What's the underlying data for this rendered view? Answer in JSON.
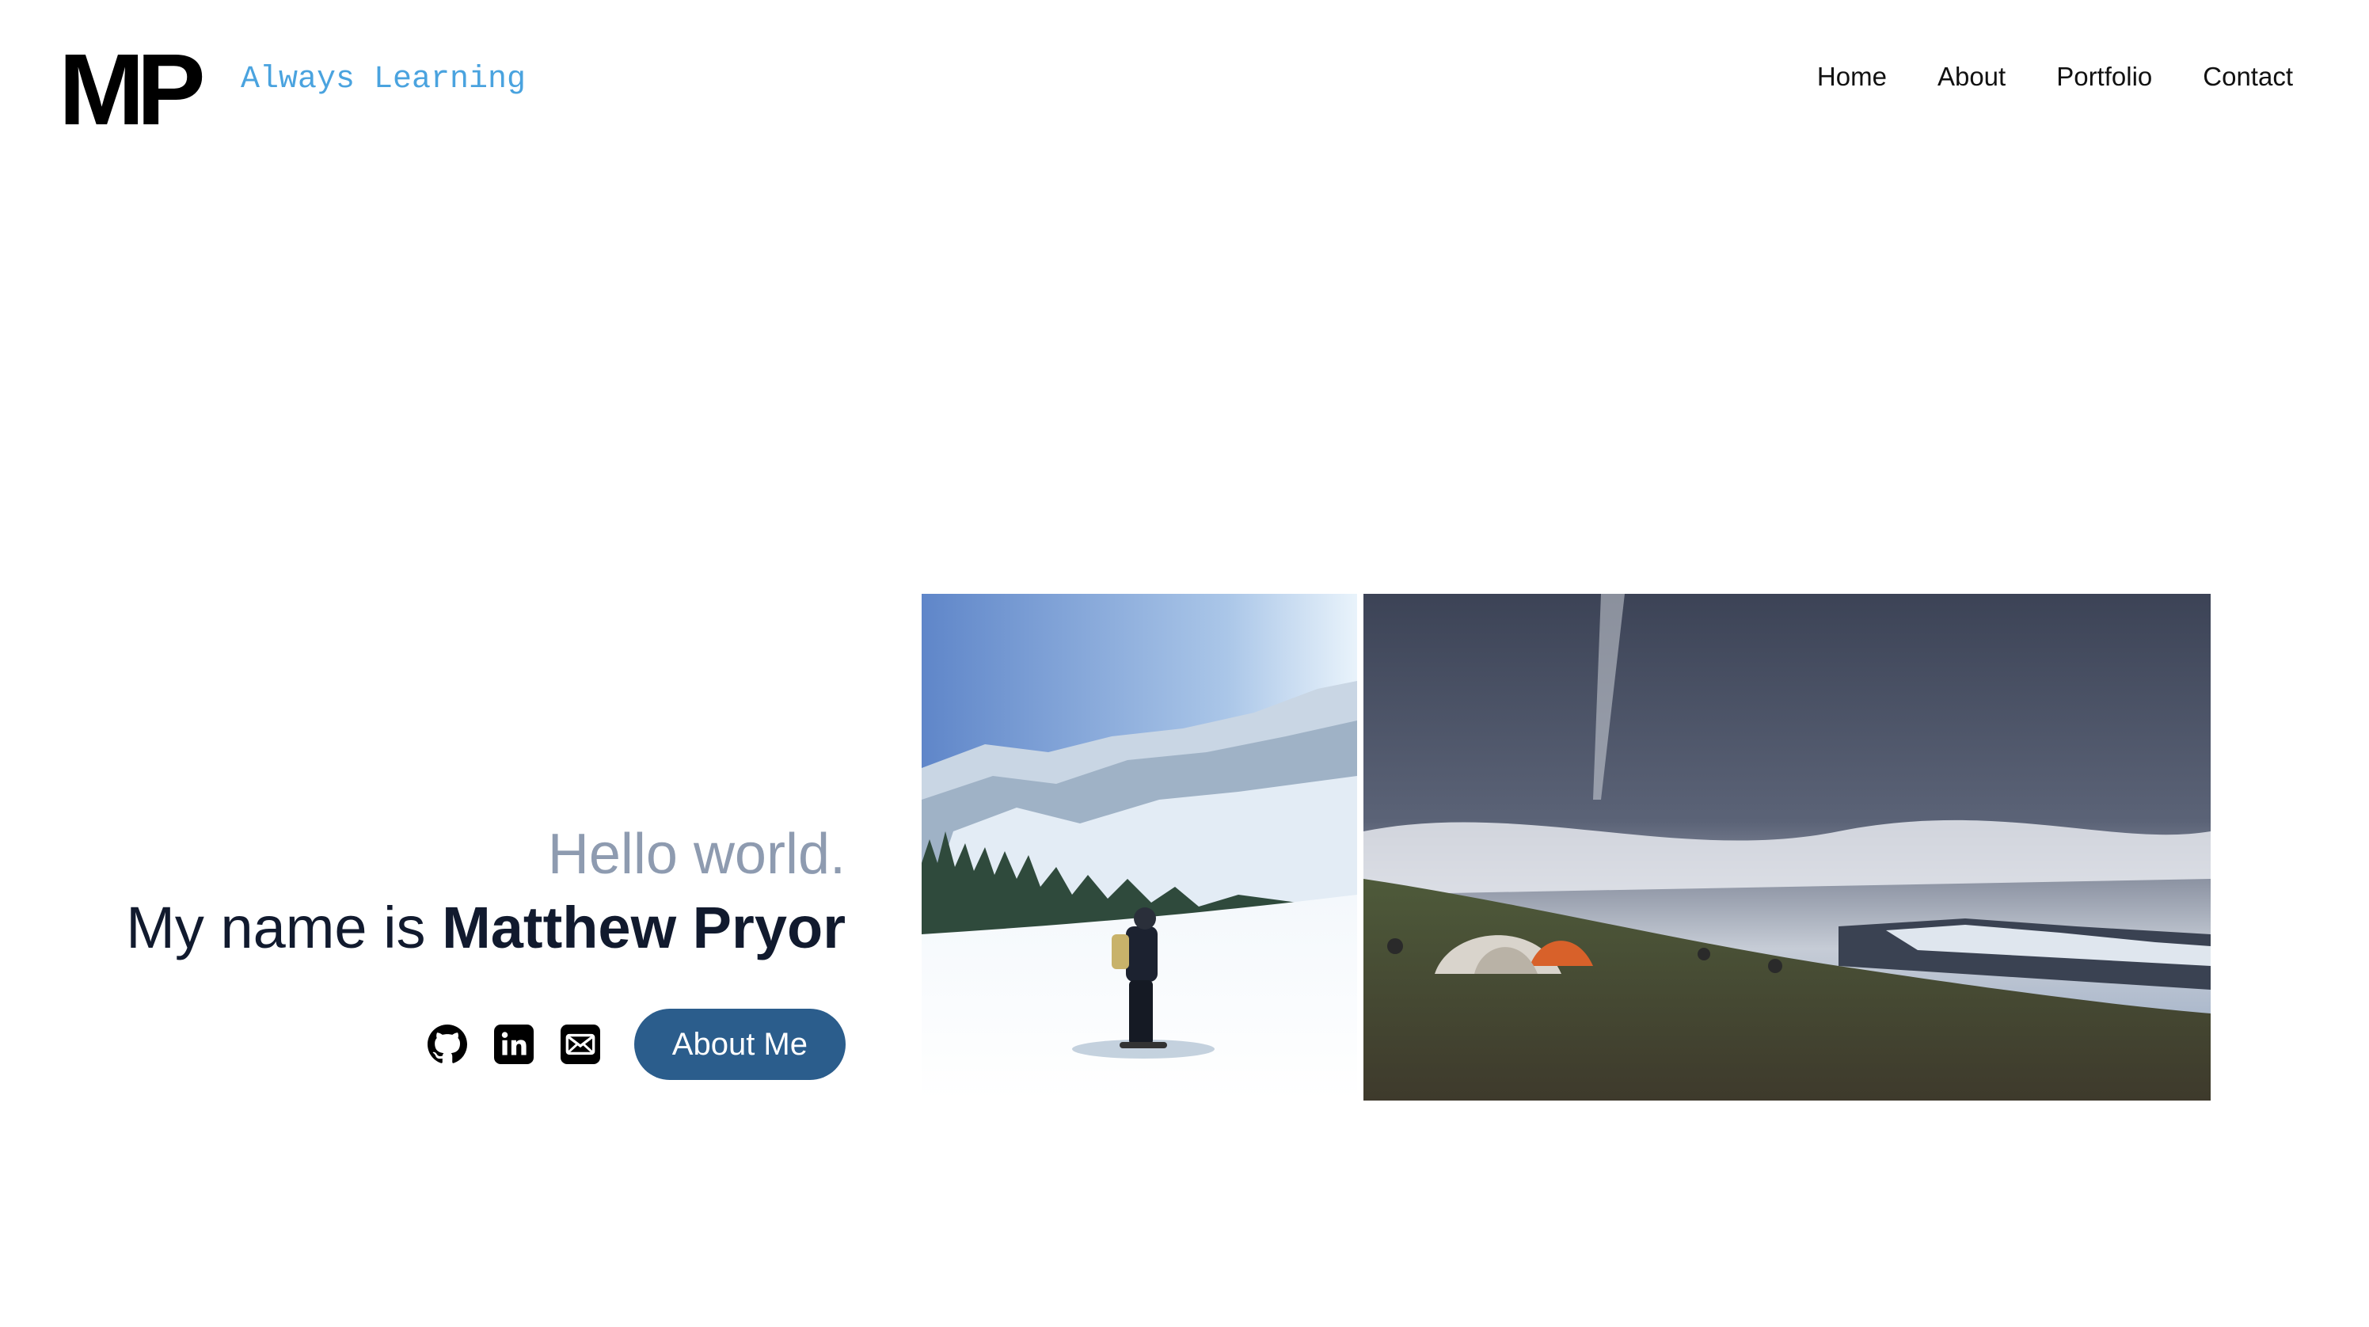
{
  "header": {
    "logo": "MP",
    "tagline": "Always Learning",
    "nav": [
      "Home",
      "About",
      "Portfolio",
      "Contact"
    ]
  },
  "hero": {
    "greeting": "Hello world.",
    "intro": "My name is",
    "name": "Matthew Pryor",
    "button_label": "About Me",
    "social_icons": [
      "github-icon",
      "linkedin-icon",
      "email-icon"
    ]
  },
  "photos": [
    {
      "subject": "snowboarder in snowy mountains"
    },
    {
      "subject": "tents on alpine plateau under cloudy sky"
    }
  ],
  "colors": {
    "tagline": "#4aa3df",
    "greeting": "#8e9bb0",
    "name": "#111a2e",
    "button": "#2b5d8c"
  }
}
